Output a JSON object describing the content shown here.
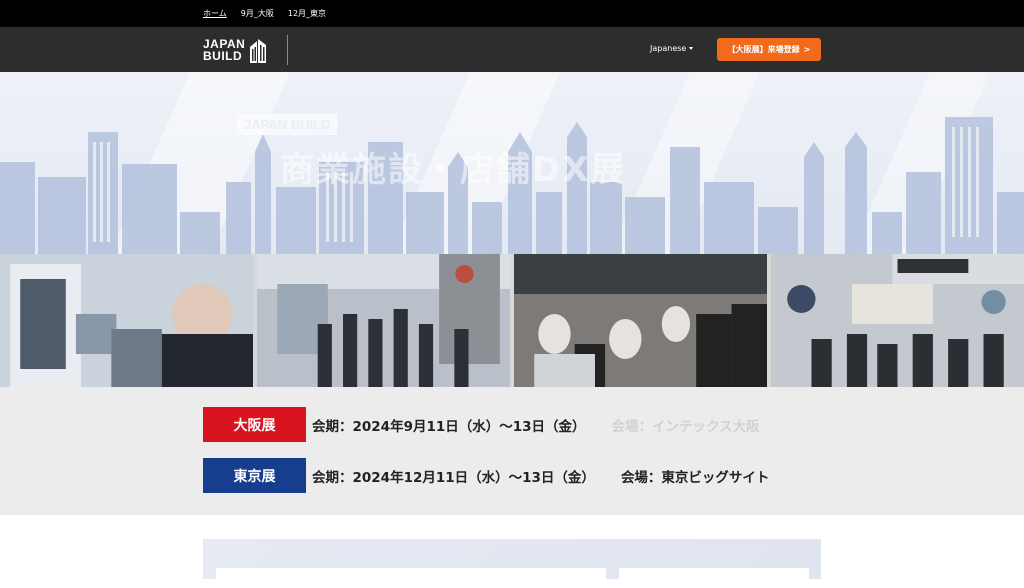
{
  "topbar": {
    "links": [
      {
        "label": "ホーム"
      },
      {
        "label": "9月_大阪"
      },
      {
        "label": "12月_東京"
      }
    ]
  },
  "header": {
    "logo_line1": "JAPAN",
    "logo_line2": "BUILD",
    "language": "Japanese",
    "cta_label": "【大阪展】来場登録",
    "cta_arrow": ">"
  },
  "hero": {
    "badge": "JAPAN BUILD",
    "title": "商業施設・店舗DX展"
  },
  "schedule": [
    {
      "tag": "大阪展",
      "period": "会期：2024年9月11日（水）～13日（金）",
      "venue": "会場：インテックス大阪"
    },
    {
      "tag": "東京展",
      "period": "会期：2024年12月11日（水）～13日（金）",
      "venue": "会場：東京ビッグサイト"
    }
  ],
  "colors": {
    "topbar": "#000000",
    "header": "#2d2d2d",
    "cta": "#f26b1d",
    "osaka_tag": "#d7141f",
    "tokyo_tag": "#173d8f",
    "dates_bg": "#ececec"
  },
  "icons": {
    "logo_mark": "building-icon",
    "language_caret": "caret-down-icon"
  }
}
